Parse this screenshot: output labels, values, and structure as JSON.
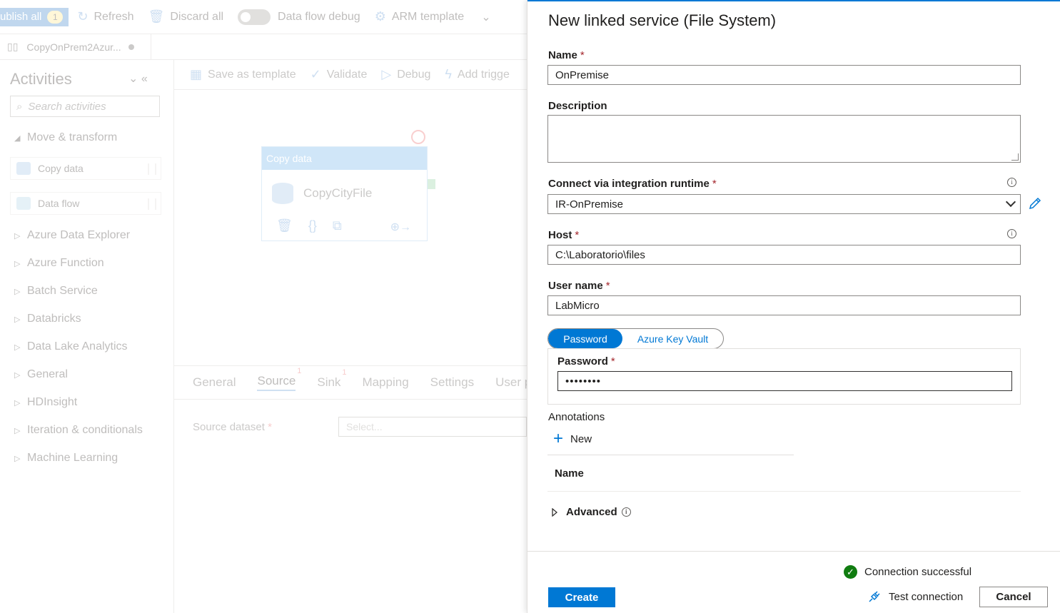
{
  "background": {
    "toolbar": {
      "publish_label": "ublish all",
      "publish_count": "1",
      "refresh": "Refresh",
      "discard": "Discard all",
      "data_flow_debug": "Data flow debug",
      "arm_template": "ARM template"
    },
    "pipeline_tab": "CopyOnPrem2Azur...",
    "activities": {
      "title": "Activities",
      "search_placeholder": "Search activities",
      "move_transform": "Move & transform",
      "items": [
        "Copy data",
        "Data flow"
      ],
      "groups": [
        "Azure Data Explorer",
        "Azure Function",
        "Batch Service",
        "Databricks",
        "Data Lake Analytics",
        "General",
        "HDInsight",
        "Iteration & conditionals",
        "Machine Learning"
      ]
    },
    "canvas_toolbar": {
      "save_template": "Save as template",
      "validate": "Validate",
      "debug": "Debug",
      "add_trigger": "Add trigge"
    },
    "node": {
      "header": "Copy data",
      "name": "CopyCityFile"
    },
    "props_tabs": [
      "General",
      "Source",
      "Sink",
      "Mapping",
      "Settings",
      "User pro"
    ],
    "source_badge": "1",
    "sink_badge": "1",
    "source_dataset_label": "Source dataset",
    "source_dataset_placeholder": "Select..."
  },
  "panel": {
    "title": "New linked service (File System)",
    "name_label": "Name",
    "name_value": "OnPremise",
    "description_label": "Description",
    "description_value": "",
    "runtime_label": "Connect via integration runtime",
    "runtime_value": "IR-OnPremise",
    "host_label": "Host",
    "host_value": "C:\\Laboratorio\\files",
    "username_label": "User name",
    "username_value": "LabMicro",
    "auth_options": [
      "Password",
      "Azure Key Vault"
    ],
    "password_label": "Password",
    "password_value": "••••••••",
    "annotations_label": "Annotations",
    "new_label": "New",
    "name_column": "Name",
    "advanced_label": "Advanced",
    "connection_status": "Connection successful",
    "create_label": "Create",
    "test_connection_label": "Test connection",
    "cancel_label": "Cancel",
    "required_mark": "*"
  },
  "colors": {
    "accent": "#0078d4",
    "required": "#a4262c",
    "success": "#107c10"
  }
}
